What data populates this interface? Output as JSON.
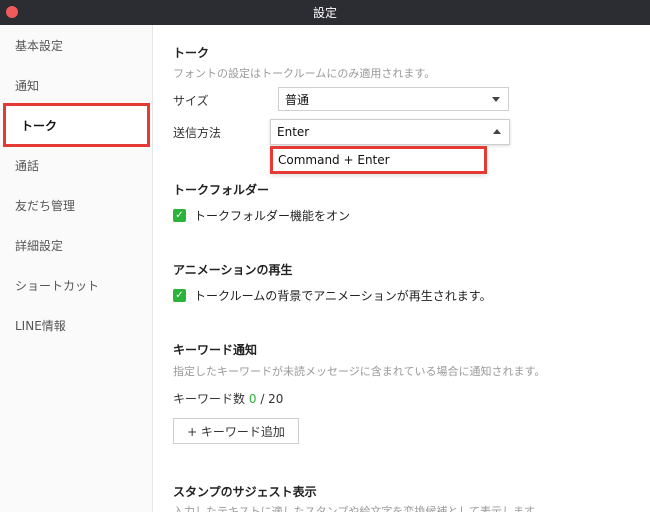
{
  "window": {
    "title": "設定"
  },
  "sidebar": {
    "items": [
      {
        "label": "基本設定"
      },
      {
        "label": "通知"
      },
      {
        "label": "トーク"
      },
      {
        "label": "通話"
      },
      {
        "label": "友だち管理"
      },
      {
        "label": "詳細設定"
      },
      {
        "label": "ショートカット"
      },
      {
        "label": "LINE情報"
      }
    ],
    "active": "トーク"
  },
  "talk": {
    "title": "トーク",
    "desc": "フォントの設定はトークルームにのみ適用されます。",
    "size_label": "サイズ",
    "size_value": "普通",
    "send_label": "送信方法",
    "send_value": "Enter",
    "send_option": "Command + Enter"
  },
  "talk_folder": {
    "title": "トークフォルダー",
    "checkbox_label": "トークフォルダー機能をオン"
  },
  "animation": {
    "title": "アニメーションの再生",
    "checkbox_label": "トークルームの背景でアニメーションが再生されます。"
  },
  "keyword": {
    "title": "キーワード通知",
    "desc": "指定したキーワードが未読メッセージに含まれている場合に通知されます。",
    "count_label": "キーワード数",
    "count_current": "0",
    "count_max": "/ 20",
    "add_button": "+ キーワード追加"
  },
  "sticker": {
    "title": "スタンプのサジェスト表示",
    "desc": "入力したテキストに適したスタンプや絵文字を変換候補として表示します。"
  },
  "colors": {
    "accent_green": "#2bb33a",
    "highlight_red": "#e53935",
    "titlebar": "#2c2c33"
  }
}
